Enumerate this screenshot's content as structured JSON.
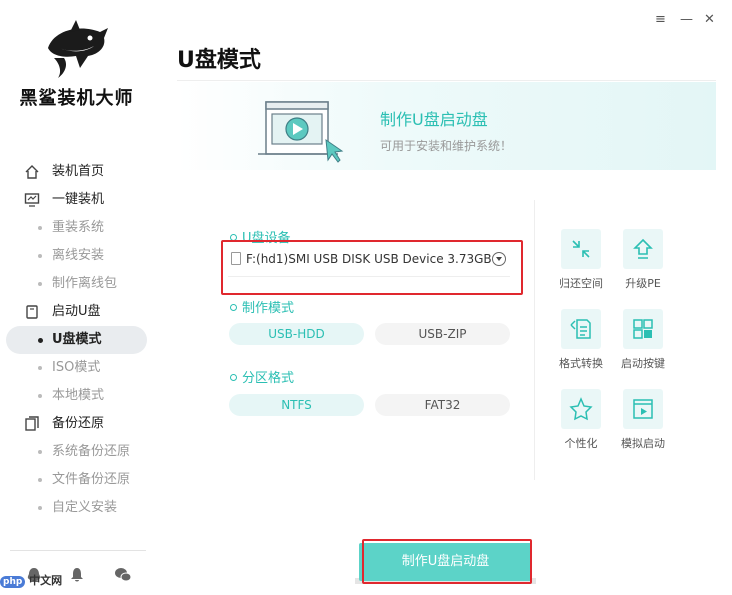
{
  "app": {
    "brand": "黑鲨装机大师",
    "window_controls": {
      "menu": "≡",
      "minimize": "—",
      "close": "✕"
    }
  },
  "sidebar": {
    "items": [
      {
        "label": "装机首页",
        "kind": "parent",
        "icon": "home-icon"
      },
      {
        "label": "一键装机",
        "kind": "parent",
        "icon": "monitor-icon"
      },
      {
        "label": "重装系统",
        "kind": "sub"
      },
      {
        "label": "离线安装",
        "kind": "sub"
      },
      {
        "label": "制作离线包",
        "kind": "sub"
      },
      {
        "label": "启动U盘",
        "kind": "parent",
        "icon": "usb-icon"
      },
      {
        "label": "U盘模式",
        "kind": "sub-active"
      },
      {
        "label": "ISO模式",
        "kind": "sub"
      },
      {
        "label": "本地模式",
        "kind": "sub"
      },
      {
        "label": "备份还原",
        "kind": "parent",
        "icon": "backup-icon"
      },
      {
        "label": "系统备份还原",
        "kind": "sub"
      },
      {
        "label": "文件备份还原",
        "kind": "sub"
      },
      {
        "label": "自定义安装",
        "kind": "sub"
      }
    ],
    "watermark": {
      "bubble": "php",
      "text": "中文网"
    }
  },
  "main": {
    "title": "U盘模式",
    "banner": {
      "title": "制作U盘启动盘",
      "subtitle": "可用于安装和维护系统！"
    },
    "device_section": {
      "label": "U盘设备",
      "selected_device": "F:(hd1)SMI USB DISK USB Device 3.73GB"
    },
    "mode_section": {
      "label": "制作模式",
      "options": [
        "USB-HDD",
        "USB-ZIP"
      ],
      "selected": "USB-HDD"
    },
    "partition_section": {
      "label": "分区格式",
      "options": [
        "NTFS",
        "FAT32"
      ],
      "selected": "NTFS"
    },
    "tools": [
      {
        "label": "归还空间",
        "icon": "shrink-icon"
      },
      {
        "label": "升级PE",
        "icon": "upgrade-icon"
      },
      {
        "label": "格式转换",
        "icon": "format-convert-icon"
      },
      {
        "label": "启动按键",
        "icon": "boot-key-icon"
      },
      {
        "label": "个性化",
        "icon": "star-icon"
      },
      {
        "label": "模拟启动",
        "icon": "simulate-boot-icon"
      }
    ],
    "make_button": "制作U盘启动盘"
  },
  "colors": {
    "accent": "#2bbfb3",
    "button": "#5cd3c8",
    "highlight_box": "#e0282e"
  }
}
